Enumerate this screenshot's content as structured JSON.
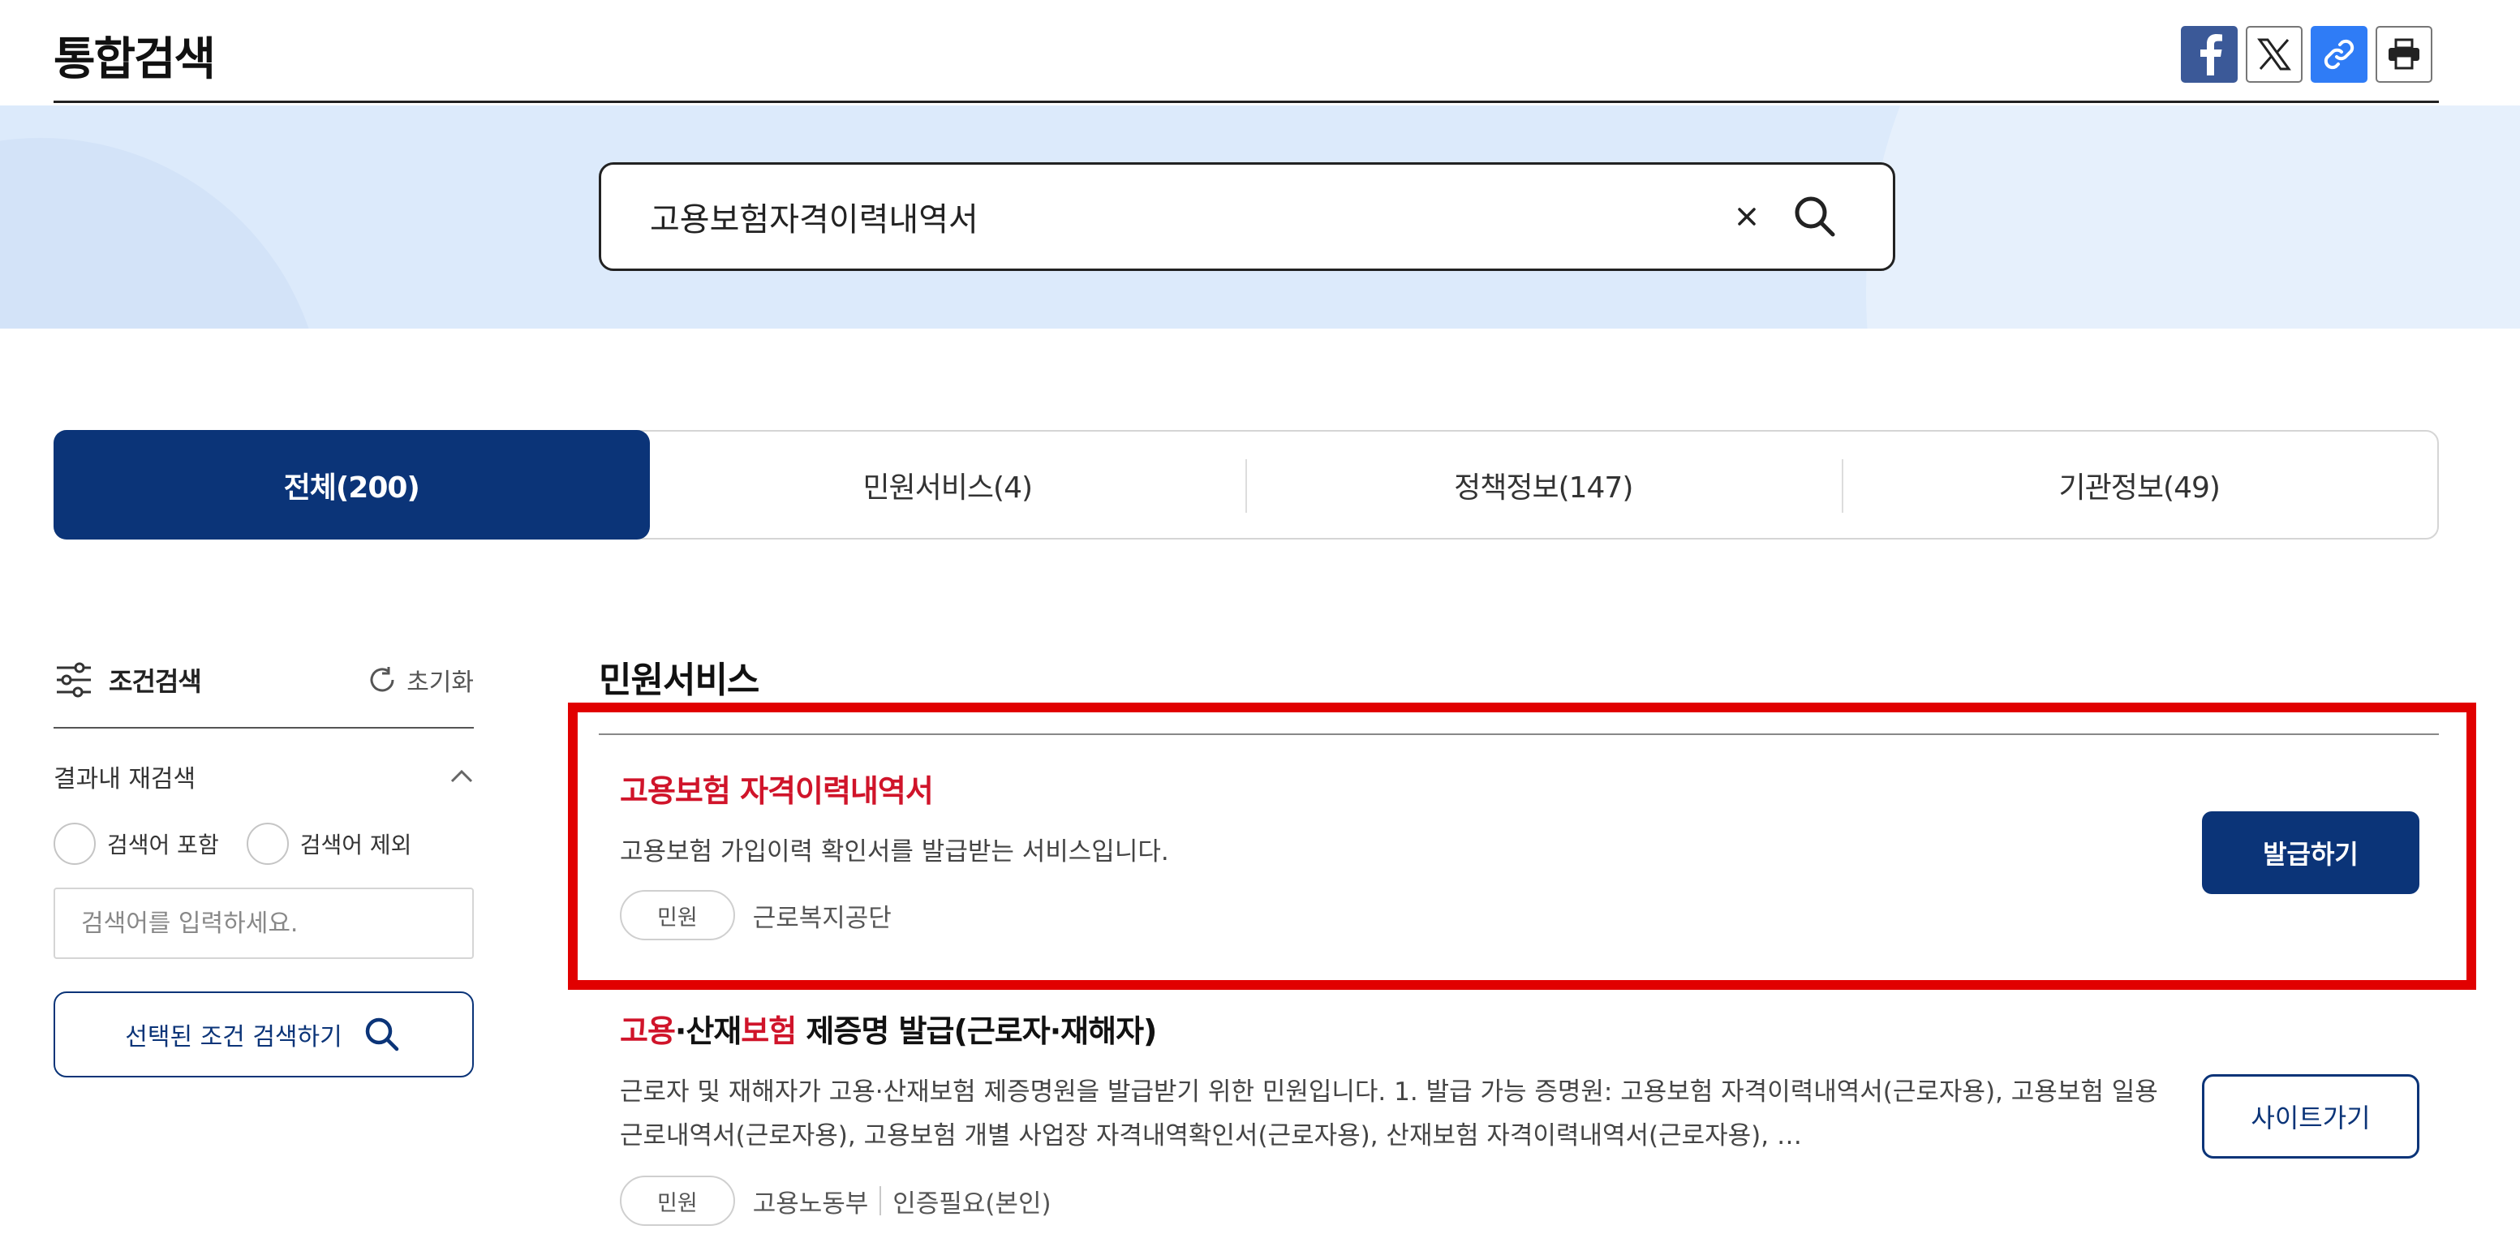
{
  "header": {
    "title": "통합검색",
    "share": [
      {
        "icon": "facebook-icon"
      },
      {
        "icon": "x-icon"
      },
      {
        "icon": "link-icon"
      },
      {
        "icon": "print-icon"
      }
    ]
  },
  "search": {
    "query": "고용보험자격이력내역서",
    "clear_icon": "close-icon",
    "search_icon": "search-icon"
  },
  "tabs": [
    {
      "label": "전체(200)",
      "active": true
    },
    {
      "label": "민원서비스(4)",
      "active": false
    },
    {
      "label": "정책정보(147)",
      "active": false
    },
    {
      "label": "기관정보(49)",
      "active": false
    }
  ],
  "sidebar": {
    "title": "조건검색",
    "reset_label": "초기화",
    "research_label": "결과내 재검색",
    "radio_include": "검색어 포함",
    "radio_exclude": "검색어 제외",
    "input_placeholder": "검색어를 입력하세요.",
    "submit_label": "선택된 조건 검색하기"
  },
  "results": {
    "section_title": "민원서비스",
    "items": [
      {
        "title": "고용보험 자격이력내역서",
        "description": "고용보험 가입이력 확인서를 발급받는 서비스입니다.",
        "tag": "민원",
        "agency": "근로복지공단",
        "button": "발급하기"
      },
      {
        "title_hl1": "고용",
        "title_mid": "·산재",
        "title_hl2": "보험",
        "title_rest": " 제증명 발급(근로자·재해자)",
        "description": "근로자 및 재해자가 고용·산재보험 제증명원을 발급받기 위한 민원입니다. 1. 발급 가능 증명원: 고용보험 자격이력내역서(근로자용), 고용보험 일용근로내역서(근로자용), 고용보험 개별 사업장 자격내역확인서(근로자용), 산재보험 자격이력내역서(근로자용), …",
        "tag": "민원",
        "agency": "고용노동부",
        "auth": "인증필요(본인)",
        "button": "사이트가기"
      }
    ]
  },
  "colors": {
    "primary": "#0b3478",
    "highlight": "#d0142a",
    "band": "#dceafb",
    "annotation": "#e10000"
  }
}
